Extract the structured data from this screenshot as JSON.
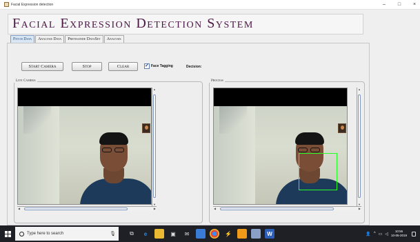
{
  "window": {
    "title": "Facial Expression detection",
    "controls": [
      "–",
      "□",
      "×"
    ]
  },
  "header": {
    "title": "Facial Expression Detection System"
  },
  "tabs": [
    {
      "label": "Fetch Data",
      "active": true
    },
    {
      "label": "Analysis Data",
      "active": false
    },
    {
      "label": "Pretrainde DataSet",
      "active": false
    },
    {
      "label": "Analysis",
      "active": false
    }
  ],
  "toolbar": {
    "start_label": "Start Camera",
    "stop_label": "Stop",
    "clear_label": "Clear",
    "face_tagging_label": "Face Tagging",
    "face_tagging_checked": true,
    "decision_label": "Decision:"
  },
  "panels": {
    "live_label": "Live Camera",
    "process_label": "Process"
  },
  "colors": {
    "title": "#4b1544",
    "face_box": "#25ff25",
    "taskbar": "#1f2026"
  },
  "taskbar": {
    "search_placeholder": "Type here to search",
    "icons": [
      "task-view-icon",
      "edge-icon",
      "file-explorer-icon",
      "store-icon",
      "mail-icon",
      "app-icon",
      "chrome-icon",
      "app-icon",
      "app-icon",
      "app-icon",
      "word-icon"
    ],
    "clock_time": "10:55",
    "clock_date": "10-05-2019"
  }
}
